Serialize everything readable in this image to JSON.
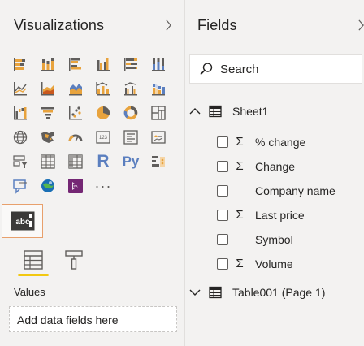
{
  "visualizations": {
    "title": "Visualizations",
    "collapse_icon": "chevron-right-icon",
    "gallery": [
      "stacked-bar-chart",
      "stacked-column-chart",
      "clustered-bar-chart",
      "clustered-column-chart",
      "100-stacked-bar-chart",
      "100-stacked-column-chart",
      "line-chart",
      "area-chart",
      "stacked-area-chart",
      "line-and-stacked-column-chart",
      "line-and-clustered-column-chart",
      "ribbon-chart",
      "waterfall-chart",
      "funnel-chart",
      "scatter-chart",
      "pie-chart",
      "donut-chart",
      "treemap",
      "map",
      "filled-map",
      "gauge",
      "card",
      "multi-row-card",
      "kpi",
      "slicer",
      "table",
      "matrix",
      "r-script-visual",
      "python-visual",
      "key-influencers",
      "decomposition-tree",
      "arcgis-map",
      "power-apps",
      "more-visuals"
    ],
    "r_letter": "R",
    "py_letters": "Py",
    "more_glyph": "···",
    "selected_visual": "custom-visual-abc",
    "tabs": [
      "fields-tab",
      "format-tab"
    ],
    "values_label": "Values",
    "drop_placeholder": "Add data fields here"
  },
  "fields": {
    "title": "Fields",
    "collapse_icon": "chevron-right-icon",
    "search_placeholder": "Search",
    "tables": [
      {
        "name": "Sheet1",
        "expanded": true,
        "fields": [
          {
            "name": "% change",
            "numeric": true,
            "checked": false
          },
          {
            "name": "Change",
            "numeric": true,
            "checked": false
          },
          {
            "name": "Company name",
            "numeric": false,
            "checked": false
          },
          {
            "name": "Last price",
            "numeric": true,
            "checked": false
          },
          {
            "name": "Symbol",
            "numeric": false,
            "checked": false
          },
          {
            "name": "Volume",
            "numeric": true,
            "checked": false
          }
        ]
      },
      {
        "name": "Table001 (Page 1)",
        "expanded": false,
        "fields": []
      }
    ],
    "sigma_glyph": "Σ"
  }
}
